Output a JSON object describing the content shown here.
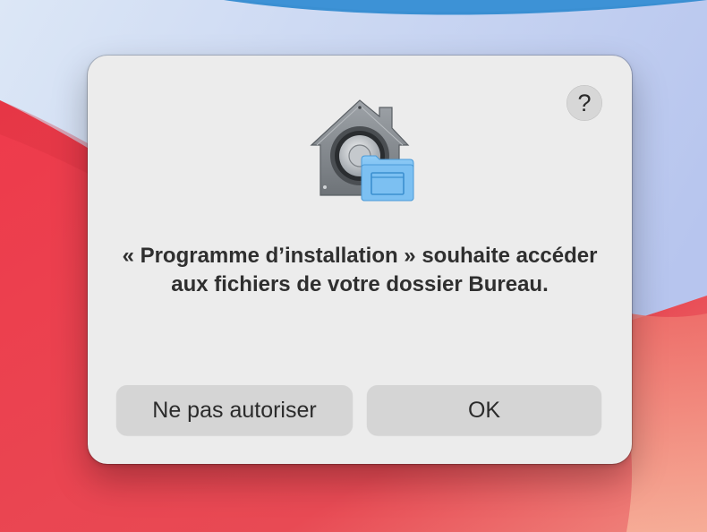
{
  "wallpaper": {
    "colors": {
      "sky_light": "#dbe6f5",
      "sky_blue": "#b9c8ee",
      "band_blue": "#3a8fd2",
      "red": "#ec3c4c",
      "red_dark": "#d42e3f",
      "peach": "#f4a592"
    }
  },
  "dialog": {
    "help_label": "?",
    "icon": "security-privacy-house-vault-icon",
    "message": "« Programme d’installation » souhaite accéder aux fichiers de votre dossier Bureau.",
    "buttons": {
      "deny": "Ne pas autoriser",
      "ok": "OK"
    }
  }
}
